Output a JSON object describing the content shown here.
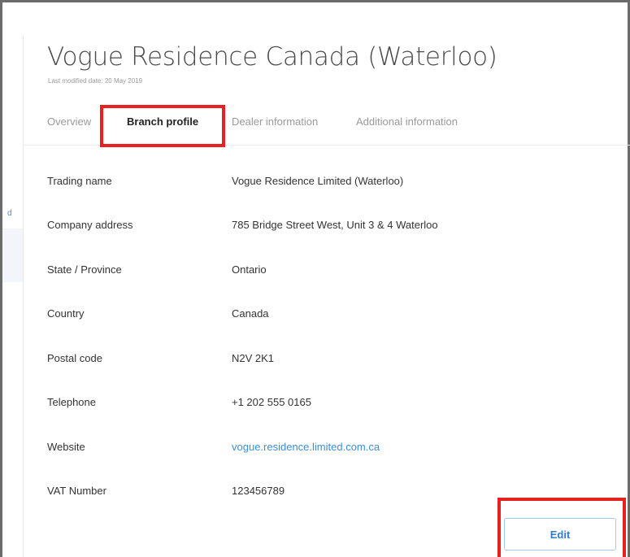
{
  "page": {
    "title": "Vogue Residence Canada (Waterloo)",
    "last_modified": "Last modified date: 20 May 2019"
  },
  "sidebar_fragment": "d",
  "tabs": [
    {
      "label": "Overview",
      "active": false
    },
    {
      "label": "Branch profile",
      "active": true
    },
    {
      "label": "Dealer information",
      "active": false
    },
    {
      "label": "Additional information",
      "active": false
    }
  ],
  "profile": [
    {
      "label": "Trading name",
      "value": "Vogue Residence Limited (Waterloo)"
    },
    {
      "label": "Company address",
      "value": "785 Bridge Street West, Unit 3 & 4 Waterloo"
    },
    {
      "label": "State / Province",
      "value": "Ontario"
    },
    {
      "label": "Country",
      "value": "Canada"
    },
    {
      "label": "Postal code",
      "value": "N2V 2K1"
    },
    {
      "label": "Telephone",
      "value": "+1 202 555 0165"
    },
    {
      "label": "Website",
      "value": "vogue.residence.limited.com.ca"
    },
    {
      "label": "VAT Number",
      "value": "123456789"
    }
  ],
  "actions": {
    "edit_label": "Edit"
  },
  "colors": {
    "highlight": "#e8201f",
    "link": "#3b8fd9",
    "active_tab": "#222222"
  }
}
